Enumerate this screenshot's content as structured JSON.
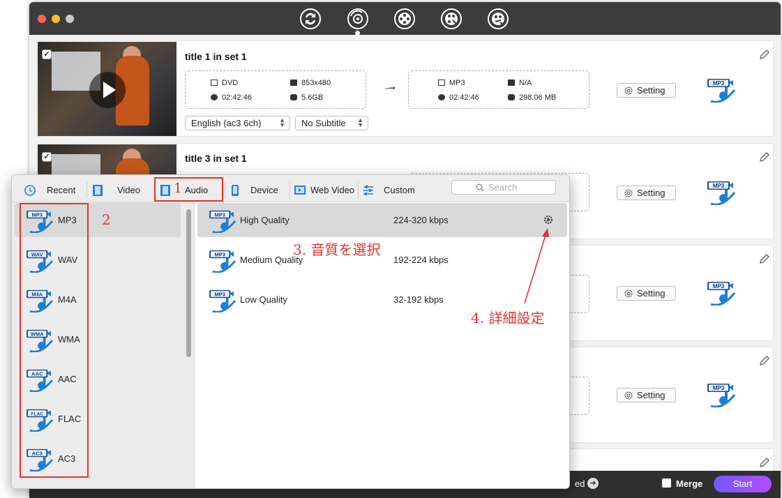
{
  "titlebar": {
    "mode_icons": [
      "convert-mode-icon",
      "rip-mode-icon",
      "copy-mode-icon",
      "video-editor-icon",
      "toolbox-icon"
    ]
  },
  "cards": [
    {
      "title": "title 1 in set 1",
      "checked": "✓",
      "src": {
        "format": "DVD",
        "resolution": "853x480",
        "duration": "02:42:46",
        "size": "5.6GB"
      },
      "dst": {
        "format": "MP3",
        "resolution": "N/A",
        "duration": "02:42:46",
        "size": "298.06 MB"
      },
      "setting": "Setting",
      "audio_select": "English (ac3 6ch)",
      "subtitle_select": "No Subtitle",
      "badge": "MP3"
    },
    {
      "title": "title 3 in set 1",
      "checked": "✓",
      "setting": "Setting",
      "badge": "MP3"
    },
    {
      "setting": "Setting",
      "badge": "MP3"
    },
    {
      "setting": "Setting",
      "badge": "MP3"
    }
  ],
  "bottombar": {
    "merged_fragment": "ed",
    "merge_label": "Merge",
    "start_label": "Start"
  },
  "popup": {
    "tabs": [
      {
        "label": "Recent"
      },
      {
        "label": "Video"
      },
      {
        "label": "Audio"
      },
      {
        "label": "Device"
      },
      {
        "label": "Web Video"
      },
      {
        "label": "Custom"
      }
    ],
    "search_placeholder": "Search",
    "formats": [
      {
        "label": "MP3",
        "badge": "MP3"
      },
      {
        "label": "WAV",
        "badge": "WAV"
      },
      {
        "label": "M4A",
        "badge": "M4A"
      },
      {
        "label": "WMA",
        "badge": "WMA"
      },
      {
        "label": "AAC",
        "badge": "AAC"
      },
      {
        "label": "FLAC",
        "badge": "FLAC"
      },
      {
        "label": "AC3",
        "badge": "AC3"
      }
    ],
    "qualities": [
      {
        "name": "High Quality",
        "range": "224-320 kbps",
        "badge": "MP3"
      },
      {
        "name": "Medium Quality",
        "range": "192-224 kbps",
        "badge": "MP3"
      },
      {
        "name": "Low Quality",
        "range": "32-192 kbps",
        "badge": "MP3"
      }
    ]
  },
  "annotations": {
    "step1": "1",
    "step2": "2",
    "step3": "3. 音質を選択",
    "step4": "4. 詳細設定"
  },
  "colors": {
    "annotation_red": "#e8312a",
    "start_gradient_from": "#6d5bff",
    "start_gradient_to": "#b54bff",
    "badge_blue": "#1d7fd6"
  }
}
